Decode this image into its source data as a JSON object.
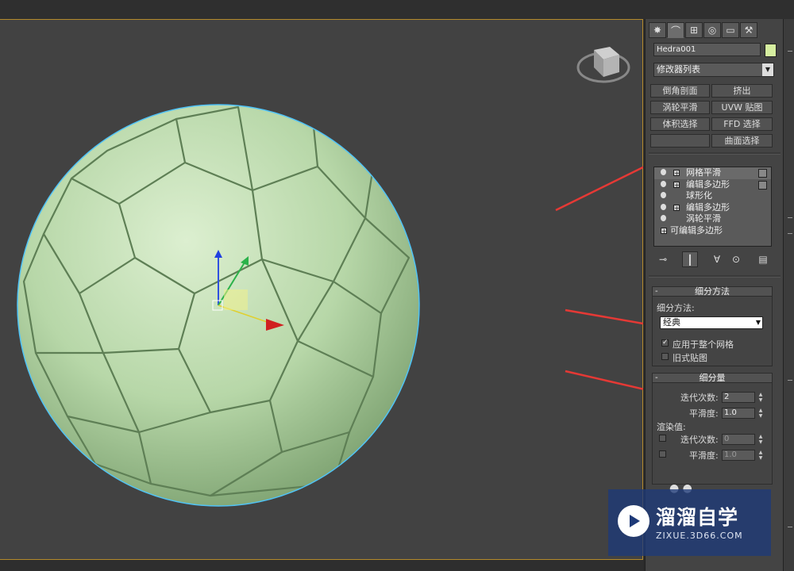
{
  "object": {
    "name": "Hedra001",
    "color": "#d6eea0"
  },
  "modifier_list": {
    "label": "修改器列表"
  },
  "modifier_buttons": [
    "倒角剖面",
    "挤出",
    "涡轮平滑",
    "UVW 贴图",
    "体积选择",
    "FFD 选择",
    "",
    "曲面选择"
  ],
  "stack": [
    {
      "label": "网格平滑",
      "bulb": true,
      "plus": true,
      "box": true,
      "selected": true
    },
    {
      "label": "编辑多边形",
      "bulb": true,
      "plus": true,
      "box": true,
      "selected": false
    },
    {
      "label": "球形化",
      "bulb": true,
      "plus": false,
      "box": false,
      "selected": false
    },
    {
      "label": "编辑多边形",
      "bulb": true,
      "plus": true,
      "box": false,
      "selected": false
    },
    {
      "label": "涡轮平滑",
      "bulb": true,
      "plus": false,
      "box": false,
      "selected": false
    },
    {
      "label": "可编辑多边形",
      "bulb": false,
      "plus": true,
      "box": false,
      "selected": false
    }
  ],
  "subdivision_method": {
    "header": "细分方法",
    "label": "细分方法:",
    "value": "经典",
    "apply_whole_mesh": {
      "label": "应用于整个网格",
      "checked": true
    },
    "old_style_mapping": {
      "label": "旧式贴图",
      "checked": false
    }
  },
  "subdivision_amount": {
    "header": "细分量",
    "iterations_label": "迭代次数:",
    "iterations_value": "2",
    "smoothness_label": "平滑度:",
    "smoothness_value": "1.0",
    "render_label": "渲染值:",
    "render_iterations_label": "迭代次数:",
    "render_iterations_value": "0",
    "render_smoothness_label": "平滑度:",
    "render_smoothness_value": "1.0"
  },
  "watermark": {
    "title": "溜溜自学",
    "url": "ZIXUE.3D66.COM"
  },
  "colors": {
    "viewport_bg": "#424242",
    "ball_green": "#b7d7a8",
    "selection_outline": "#4fc3f7",
    "annotation_arrow": "#e53935",
    "viewport_border": "#b48a2c"
  }
}
